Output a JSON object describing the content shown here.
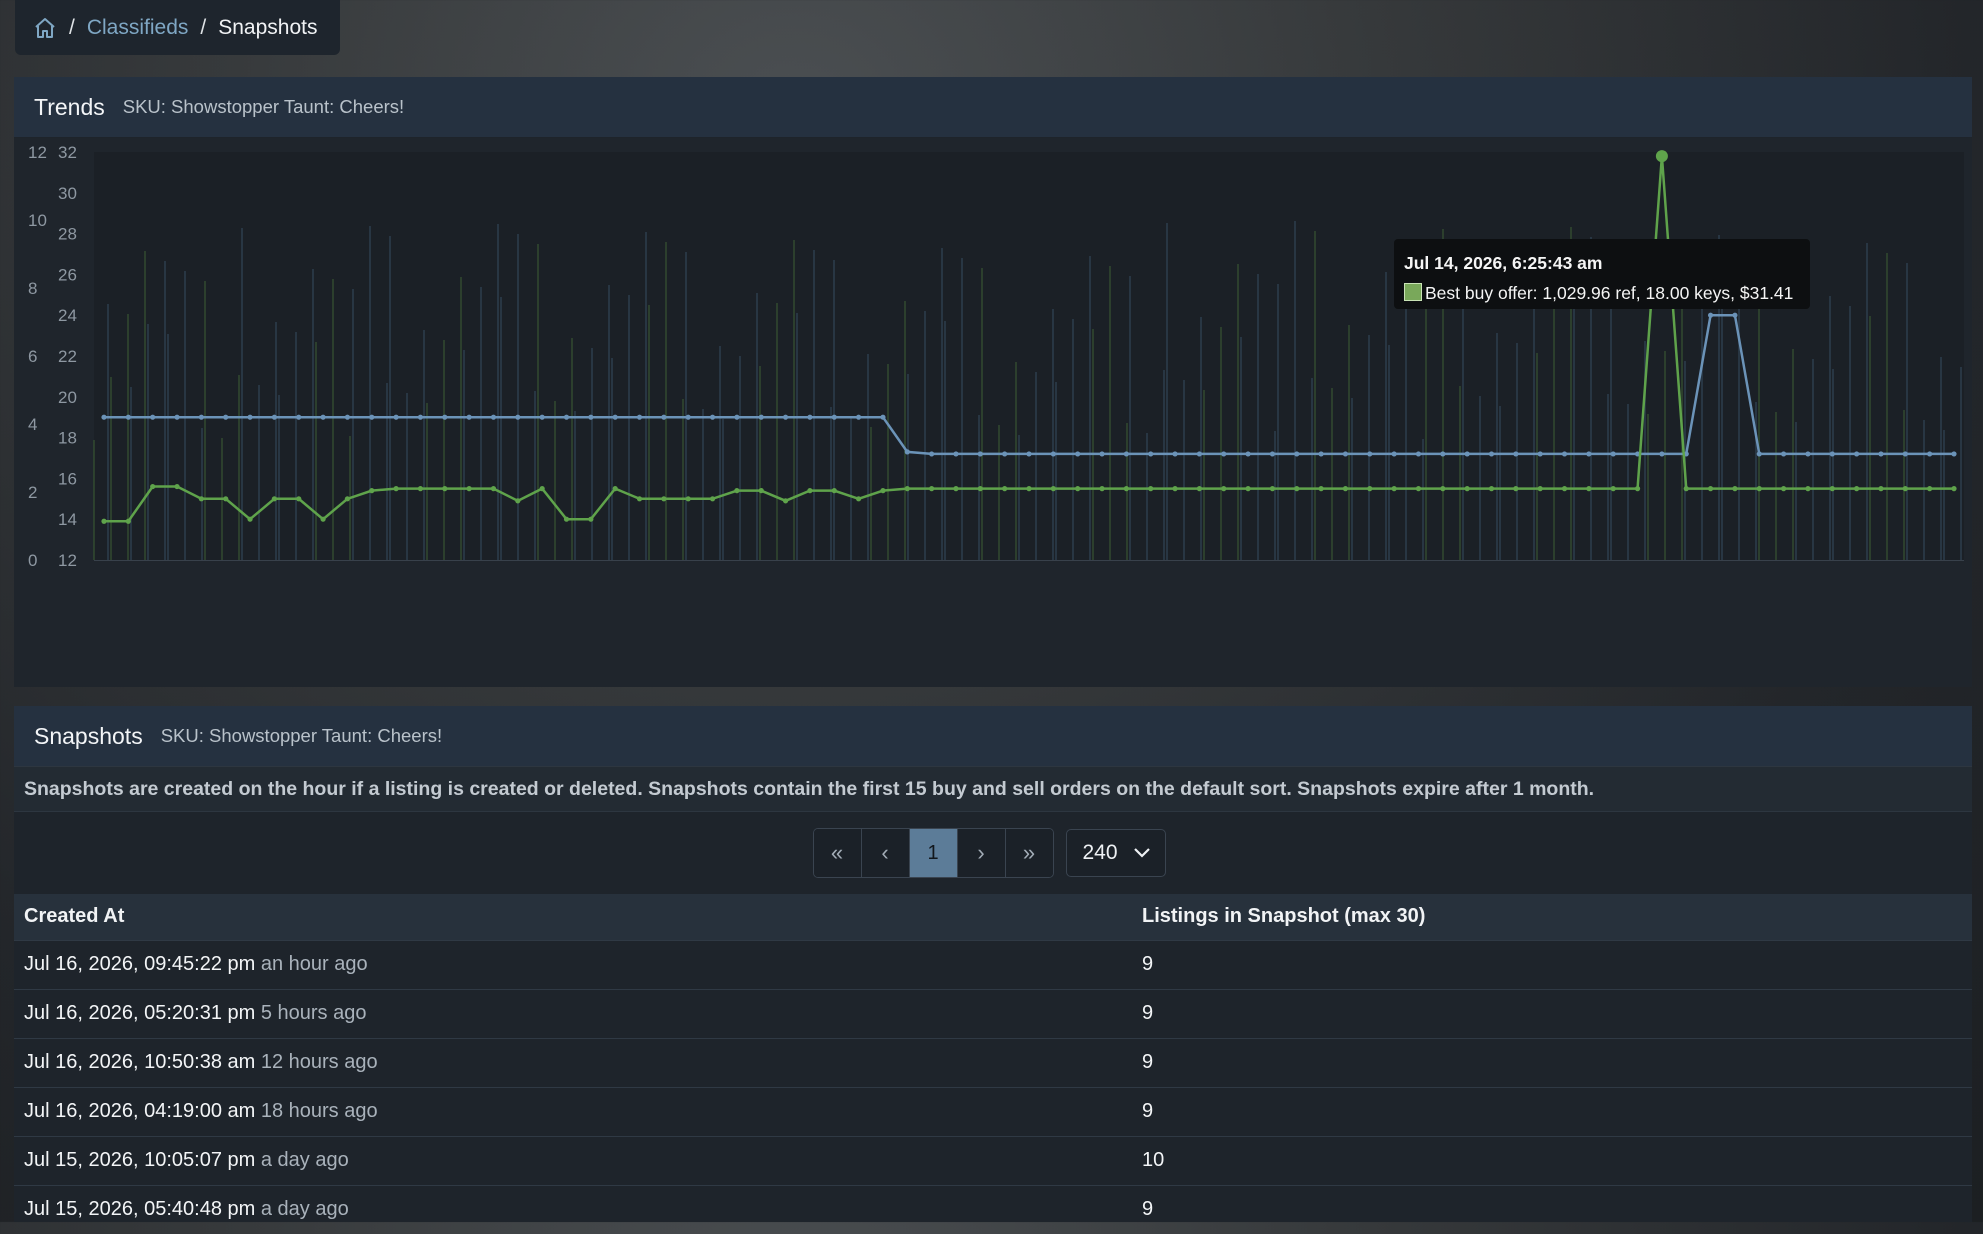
{
  "breadcrumb": {
    "home_icon": "home-icon",
    "items": [
      "Classifieds",
      "Snapshots"
    ],
    "separator": "/"
  },
  "trends": {
    "title": "Trends",
    "sku": "SKU: Showstopper Taunt: Cheers!"
  },
  "chart_data": {
    "type": "line",
    "left_axis_ticks": [
      "0",
      "2",
      "4",
      "6",
      "8",
      "10",
      "12"
    ],
    "right_axis_ticks": [
      "12",
      "14",
      "16",
      "18",
      "20",
      "22",
      "24",
      "26",
      "28",
      "30",
      "32"
    ],
    "ylim_left": [
      0,
      12
    ],
    "ylim_right": [
      12,
      32
    ],
    "series": [
      {
        "color": "#6b93b8",
        "values": [
          19,
          19,
          19,
          19,
          19,
          19,
          19,
          19,
          19,
          19,
          19,
          19,
          19,
          19,
          19,
          19,
          19,
          19,
          19,
          19,
          19,
          19,
          19,
          19,
          19,
          19,
          19,
          19,
          19,
          19,
          19,
          19,
          19,
          17.3,
          17.2,
          17.2,
          17.2,
          17.2,
          17.2,
          17.2,
          17.2,
          17.2,
          17.2,
          17.2,
          17.2,
          17.2,
          17.2,
          17.2,
          17.2,
          17.2,
          17.2,
          17.2,
          17.2,
          17.2,
          17.2,
          17.2,
          17.2,
          17.2,
          17.2,
          17.2,
          17.2,
          17.2,
          17.2,
          17.2,
          17.2,
          17.2,
          24,
          24,
          17.2,
          17.2,
          17.2,
          17.2,
          17.2,
          17.2,
          17.2,
          17.2,
          17.2
        ]
      },
      {
        "color": "#5fa34b",
        "values": [
          13.9,
          13.9,
          15.6,
          15.6,
          15,
          15,
          14,
          15,
          15,
          14,
          15,
          15.4,
          15.5,
          15.5,
          15.5,
          15.5,
          15.5,
          14.9,
          15.5,
          14,
          14,
          15.5,
          15,
          15,
          15,
          15,
          15.4,
          15.4,
          14.9,
          15.4,
          15.4,
          15,
          15.4,
          15.5,
          15.5,
          15.5,
          15.5,
          15.5,
          15.5,
          15.5,
          15.5,
          15.5,
          15.5,
          15.5,
          15.5,
          15.5,
          15.5,
          15.5,
          15.5,
          15.5,
          15.5,
          15.5,
          15.5,
          15.5,
          15.5,
          15.5,
          15.5,
          15.5,
          15.5,
          15.5,
          15.5,
          15.5,
          15.5,
          15.5,
          31.8,
          15.5,
          15.5,
          15.5,
          15.5,
          15.5,
          15.5,
          15.5,
          15.5,
          15.5,
          15.5,
          15.5,
          15.5
        ]
      }
    ]
  },
  "tooltip": {
    "date": "Jul 14, 2026, 6:25:43 am",
    "text": "Best buy offer: 1,029.96 ref, 18.00 keys, $31.41"
  },
  "snapshots": {
    "title": "Snapshots",
    "sku": "SKU: Showstopper Taunt: Cheers!",
    "notice": "Snapshots are created on the hour if a listing is created or deleted. Snapshots contain the first 15 buy and sell orders on the default sort. Snapshots expire after 1 month.",
    "pager": {
      "first": "«",
      "prev": "‹",
      "page": "1",
      "next": "›",
      "last": "»",
      "per_page": "240"
    },
    "columns": [
      "Created At",
      "Listings in Snapshot (max 30)"
    ],
    "rows": [
      {
        "date": "Jul 16, 2026, 09:45:22 pm",
        "ago": "an hour ago",
        "count": "9"
      },
      {
        "date": "Jul 16, 2026, 05:20:31 pm",
        "ago": "5 hours ago",
        "count": "9"
      },
      {
        "date": "Jul 16, 2026, 10:50:38 am",
        "ago": "12 hours ago",
        "count": "9"
      },
      {
        "date": "Jul 16, 2026, 04:19:00 am",
        "ago": "18 hours ago",
        "count": "9"
      },
      {
        "date": "Jul 15, 2026, 10:05:07 pm",
        "ago": "a day ago",
        "count": "10"
      },
      {
        "date": "Jul 15, 2026, 05:40:48 pm",
        "ago": "a day ago",
        "count": "9"
      }
    ]
  }
}
